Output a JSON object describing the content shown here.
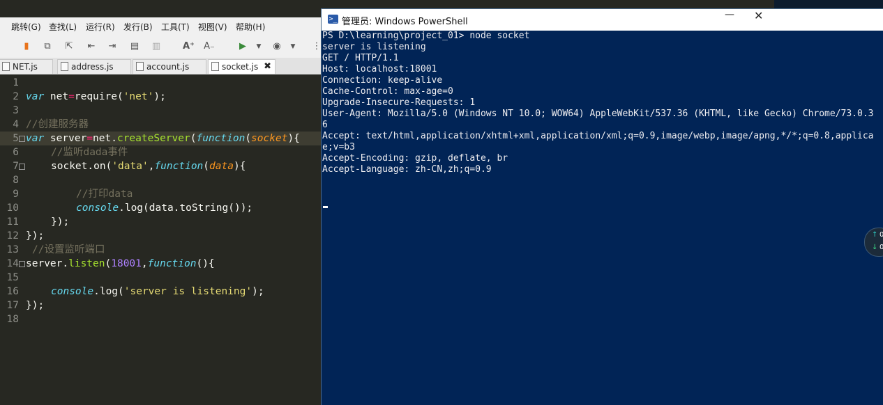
{
  "editor": {
    "menu": [
      "跳转(G)",
      "查找(L)",
      "运行(R)",
      "发行(B)",
      "工具(T)",
      "视图(V)",
      "帮助(H)"
    ],
    "tabs": [
      {
        "label": "NET.js",
        "active": false
      },
      {
        "label": "address.js",
        "active": false
      },
      {
        "label": "account.js",
        "active": false
      },
      {
        "label": "socket.js",
        "active": true,
        "close": "✖"
      }
    ],
    "line_numbers": [
      "1",
      "2",
      "3",
      "4",
      "5",
      "6",
      "7",
      "8",
      "9",
      "10",
      "11",
      "12",
      "13",
      "14",
      "15",
      "16",
      "17",
      "18"
    ],
    "code": {
      "l2": {
        "kw": "var",
        "a": " net",
        "op": "=",
        "b": "require(",
        "str": "'net'",
        "c": ");"
      },
      "l4": {
        "cm": "//创建服务器"
      },
      "l5": {
        "kw": "var",
        "a": " server",
        "op": "=",
        "b": "net.",
        "fn": "createServer",
        "c": "(",
        "kw2": "function",
        "d": "(",
        "prm": "socket",
        "e": "){"
      },
      "l6": {
        "cm": "//监听dada事件"
      },
      "l7": {
        "a": "socket.on(",
        "str": "'data'",
        "b": ",",
        "kw": "function",
        "c": "(",
        "prm": "data",
        "d": "){"
      },
      "l9": {
        "cm": "//打印data"
      },
      "l10": {
        "kw": "console",
        "a": ".log(data.toString());"
      },
      "l11": {
        "a": "});"
      },
      "l12": {
        "a": "});"
      },
      "l13": {
        "cm": "//设置监听端口"
      },
      "l14": {
        "a": "server.",
        "fn": "listen",
        "b": "(",
        "num": "18001",
        "c": ",",
        "kw": "function",
        "d": "(){"
      },
      "l16": {
        "kw": "console",
        "a": ".log(",
        "str": "'server is listening'",
        "b": ");"
      },
      "l17": {
        "a": "});"
      }
    }
  },
  "powershell": {
    "title": "管理员: Windows PowerShell",
    "minimize": "—",
    "close": "✕",
    "lines": [
      "PS D:\\learning\\project_01> node socket",
      "server is listening",
      "GET / HTTP/1.1",
      "Host: localhost:18001",
      "Connection: keep-alive",
      "Cache-Control: max-age=0",
      "Upgrade-Insecure-Requests: 1",
      "User-Agent: Mozilla/5.0 (Windows NT 10.0; WOW64) AppleWebKit/537.36 (KHTML, like Gecko) Chrome/73.0.3",
      "6",
      "Accept: text/html,application/xhtml+xml,application/xml;q=0.9,image/webp,image/apng,*/*;q=0.8,applica",
      "e;v=b3",
      "Accept-Encoding: gzip, deflate, br",
      "Accept-Language: zh-CN,zh;q=0.9"
    ]
  },
  "widget": {
    "up_icon": "↑",
    "down_icon": "↓",
    "up_text": "0",
    "down_text": "0"
  },
  "icons": [
    "bookmark-icon",
    "new-file-icon",
    "open-file-icon",
    "indent-left-icon",
    "indent-right-icon",
    "comment-icon",
    "uncomment-icon",
    "font-increase-icon",
    "font-decrease-icon",
    "run-icon",
    "debug-icon",
    "powershell-icon"
  ]
}
